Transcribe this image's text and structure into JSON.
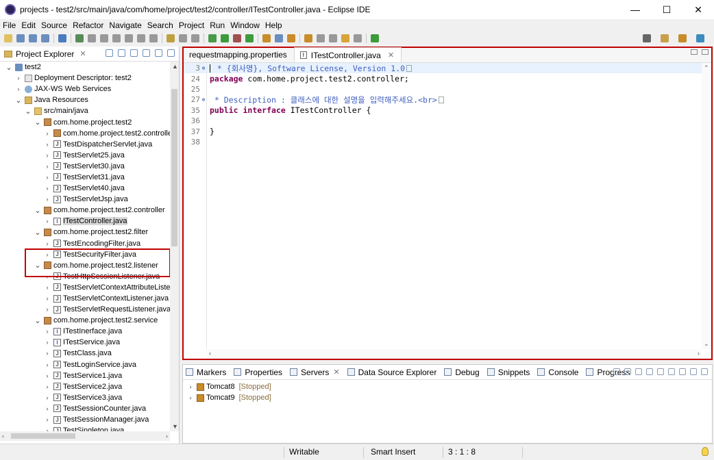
{
  "window": {
    "title": "projects - test2/src/main/java/com/home/project/test2/controller/ITestController.java - Eclipse IDE",
    "minimize": "—",
    "maximize": "☐",
    "close": "✕"
  },
  "menu": [
    "File",
    "Edit",
    "Source",
    "Refactor",
    "Navigate",
    "Search",
    "Project",
    "Run",
    "Window",
    "Help"
  ],
  "explorer": {
    "tab_label": "Project Explorer",
    "tree": [
      {
        "label": "test2",
        "indent": 0,
        "icon": "project-icon",
        "expanded": true
      },
      {
        "label": "Deployment Descriptor: test2",
        "indent": 1,
        "icon": "descriptor-icon",
        "expanded": false
      },
      {
        "label": "JAX-WS Web Services",
        "indent": 1,
        "icon": "webservice-icon",
        "expanded": false
      },
      {
        "label": "Java Resources",
        "indent": 1,
        "icon": "resources-icon",
        "expanded": true
      },
      {
        "label": "src/main/java",
        "indent": 2,
        "icon": "source-folder-icon",
        "expanded": true
      },
      {
        "label": "com.home.project.test2",
        "indent": 3,
        "icon": "package-icon",
        "expanded": true
      },
      {
        "label": "com.home.project.test2.controlle",
        "indent": 4,
        "icon": "package-icon",
        "expanded": false
      },
      {
        "label": "TestDispatcherServlet.java",
        "indent": 4,
        "icon": "java-file-icon",
        "expanded": false
      },
      {
        "label": "TestServlet25.java",
        "indent": 4,
        "icon": "java-file-icon",
        "expanded": false
      },
      {
        "label": "TestServlet30.java",
        "indent": 4,
        "icon": "java-file-icon",
        "expanded": false
      },
      {
        "label": "TestServlet31.java",
        "indent": 4,
        "icon": "java-file-icon",
        "expanded": false
      },
      {
        "label": "TestServlet40.java",
        "indent": 4,
        "icon": "java-file-icon",
        "expanded": false
      },
      {
        "label": "TestServletJsp.java",
        "indent": 4,
        "icon": "java-file-icon",
        "expanded": false
      },
      {
        "label": "com.home.project.test2.controller",
        "indent": 3,
        "icon": "package-icon",
        "expanded": true
      },
      {
        "label": "ITestController.java",
        "indent": 4,
        "icon": "interface-file-icon",
        "expanded": false,
        "selected": true
      },
      {
        "label": "com.home.project.test2.filter",
        "indent": 3,
        "icon": "package-icon",
        "expanded": true
      },
      {
        "label": "TestEncodingFilter.java",
        "indent": 4,
        "icon": "java-file-icon",
        "expanded": false
      },
      {
        "label": "TestSecurityFilter.java",
        "indent": 4,
        "icon": "java-file-icon",
        "expanded": false
      },
      {
        "label": "com.home.project.test2.listener",
        "indent": 3,
        "icon": "package-icon",
        "expanded": true
      },
      {
        "label": "TestHttpSessionListener.java",
        "indent": 4,
        "icon": "java-file-icon",
        "expanded": false
      },
      {
        "label": "TestServletContextAttributeListe",
        "indent": 4,
        "icon": "java-file-icon",
        "expanded": false
      },
      {
        "label": "TestServletContextListener.java",
        "indent": 4,
        "icon": "java-file-icon",
        "expanded": false
      },
      {
        "label": "TestServletRequestListener.java",
        "indent": 4,
        "icon": "java-file-icon",
        "expanded": false
      },
      {
        "label": "com.home.project.test2.service",
        "indent": 3,
        "icon": "package-icon",
        "expanded": true
      },
      {
        "label": "ITestInerface.java",
        "indent": 4,
        "icon": "interface-file-icon",
        "expanded": false
      },
      {
        "label": "ITestService.java",
        "indent": 4,
        "icon": "interface-file-icon",
        "expanded": false
      },
      {
        "label": "TestClass.java",
        "indent": 4,
        "icon": "java-file-icon",
        "expanded": false
      },
      {
        "label": "TestLoginService.java",
        "indent": 4,
        "icon": "java-file-icon",
        "expanded": false
      },
      {
        "label": "TestService1.java",
        "indent": 4,
        "icon": "java-file-icon",
        "expanded": false
      },
      {
        "label": "TestService2.java",
        "indent": 4,
        "icon": "java-file-icon",
        "expanded": false
      },
      {
        "label": "TestService3.java",
        "indent": 4,
        "icon": "java-file-icon",
        "expanded": false
      },
      {
        "label": "TestSessionCounter.java",
        "indent": 4,
        "icon": "java-file-icon",
        "expanded": false
      },
      {
        "label": "TestSessionManager.java",
        "indent": 4,
        "icon": "java-file-icon",
        "expanded": false
      },
      {
        "label": "TestSingleton.java",
        "indent": 4,
        "icon": "java-file-icon",
        "expanded": false
      }
    ]
  },
  "editor": {
    "tabs": [
      {
        "label": "requestmapping.properties",
        "active": false
      },
      {
        "label": "ITestController.java",
        "active": true
      }
    ],
    "lines": [
      {
        "num": "3",
        "fold": "⊕",
        "parts": [
          {
            "t": " * {회사명}, Software License, Version 1.0",
            "c": "cm"
          }
        ],
        "caret": true,
        "box": true
      },
      {
        "num": "24",
        "fold": "",
        "parts": [
          {
            "t": "package",
            "c": "kw"
          },
          {
            "t": " com.home.project.test2.controller;",
            "c": ""
          }
        ]
      },
      {
        "num": "25",
        "fold": "",
        "parts": []
      },
      {
        "num": "27",
        "fold": "⊕",
        "parts": [
          {
            "t": " * Description : 클래스에 대한 설명을 입력해주세요.<br>",
            "c": "cm"
          }
        ],
        "box": true
      },
      {
        "num": "35",
        "fold": "",
        "parts": [
          {
            "t": "public",
            "c": "kw"
          },
          {
            "t": " ",
            "c": ""
          },
          {
            "t": "interface",
            "c": "kw"
          },
          {
            "t": " ITestController {",
            "c": ""
          }
        ]
      },
      {
        "num": "36",
        "fold": "",
        "parts": []
      },
      {
        "num": "37",
        "fold": "",
        "parts": [
          {
            "t": "}",
            "c": ""
          }
        ]
      },
      {
        "num": "38",
        "fold": "",
        "parts": []
      }
    ]
  },
  "bottom_panel": {
    "tabs": [
      "Markers",
      "Properties",
      "Servers",
      "Data Source Explorer",
      "Debug",
      "Snippets",
      "Console",
      "Progress"
    ],
    "active_tab": "Servers",
    "servers": [
      {
        "name": "Tomcat8",
        "state": "[Stopped]"
      },
      {
        "name": "Tomcat9",
        "state": "[Stopped]"
      }
    ]
  },
  "status": {
    "writable": "Writable",
    "insert_mode": "Smart Insert",
    "position": "3 : 1 : 8"
  },
  "colors": {
    "highlight_border": "#c00000",
    "keyword": "#7f0055",
    "comment": "#3f5fbf"
  }
}
